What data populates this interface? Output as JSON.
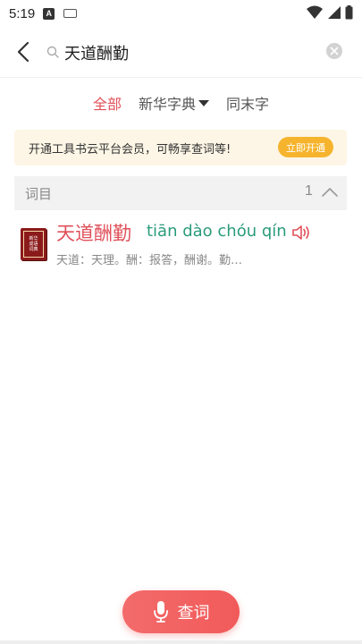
{
  "status_bar": {
    "time": "5:19",
    "a_badge": "A"
  },
  "search": {
    "query": "天道酬勤"
  },
  "filter_tabs": [
    {
      "label": "全部",
      "active": true
    },
    {
      "label": "新华字典",
      "active": false
    },
    {
      "label": "同末字",
      "active": false
    }
  ],
  "promo": {
    "text": "开通工具书云平台会员，可畅享查词等!",
    "button": "立即开通"
  },
  "section": {
    "title": "词目",
    "count": "1"
  },
  "entry": {
    "word": "天道酬勤",
    "pinyin": "tiān dào chóu qín",
    "definition": "天道：天理。酬：报答，酬谢。勤…",
    "book_lines": [
      "新华",
      "成语",
      "词典"
    ]
  },
  "bottom_button": {
    "label": "查词"
  },
  "colors": {
    "accent": "#e0505a",
    "pinyin": "#2a9c7b",
    "promo_bg": "#fdf6e6",
    "promo_btn": "#f6b42e"
  }
}
